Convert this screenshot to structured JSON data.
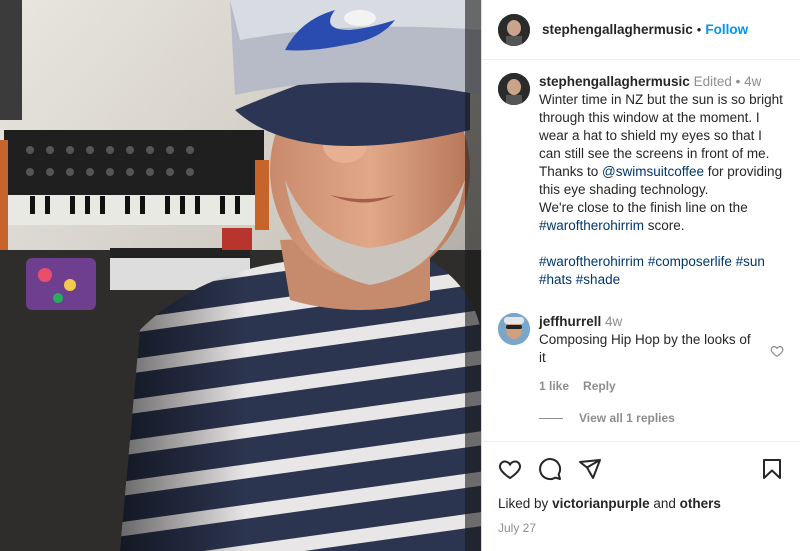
{
  "post": {
    "author": "stephengallaghermusic",
    "follow_label": "Follow",
    "separator": "•"
  },
  "caption": {
    "author": "stephengallaghermusic",
    "edited": "Edited",
    "time": "4w",
    "text_1": "Winter time in NZ but the sun is so bright through this window at the moment. I wear a hat to shield my eyes so that I can still see the screens in front of me. Thanks to ",
    "mention": "@swimsuitcoffee",
    "text_2": " for providing this eye shading technology.\nWe're close to the finish line on the ",
    "hashtag_1": "#waroftherohirrim",
    "text_3": " score.",
    "hashtags": [
      "#waroftherohirrim",
      "#composerlife",
      "#sun",
      "#hats",
      "#shade"
    ]
  },
  "comment": {
    "author": "jeffhurrell",
    "time": "4w",
    "text": "Composing Hip Hop by the looks of it",
    "likes_label": "1 like",
    "reply_label": "Reply",
    "view_replies": "View all 1 replies"
  },
  "footer": {
    "liked_by_prefix": "Liked by",
    "liked_by_user": "victorianpurple",
    "liked_by_and": "and",
    "liked_by_others": "others",
    "date": "July 27"
  },
  "icons": {
    "like": "heart-icon",
    "comment": "comment-icon",
    "share": "share-icon",
    "save": "bookmark-icon",
    "comment_like": "heart-icon"
  },
  "colors": {
    "link": "#00376b",
    "follow": "#0095f6",
    "muted": "#8e8e8e",
    "text": "#262626"
  }
}
